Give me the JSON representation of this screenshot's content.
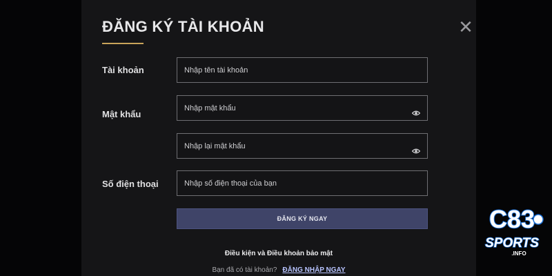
{
  "modal": {
    "title": "ĐĂNG KÝ TÀI KHOẢN",
    "close_glyph": "✕"
  },
  "form": {
    "username": {
      "label": "Tài khoản",
      "placeholder": "Nhập tên tài khoản",
      "value": ""
    },
    "password": {
      "label": "Mật khẩu",
      "placeholder": "Nhập mật khẩu",
      "value": "",
      "icon": "eye-icon"
    },
    "confirm_password": {
      "placeholder": "Nhập lại mật khẩu",
      "value": "",
      "icon": "eye-icon"
    },
    "phone": {
      "label": "Số điện thoại",
      "placeholder": "Nhập số điện thoại của bạn",
      "value": ""
    },
    "submit_label": "ĐĂNG KÝ NGAY"
  },
  "footer": {
    "terms_label": "Điều kiện và Điều khoản bảo mật",
    "login_prompt": "Bạn đã có tài khoản?",
    "login_link": "ĐĂNG NHẬP NGAY"
  },
  "logo": {
    "brand": "C83",
    "sub": "SPORTS",
    "tld": ".INFO"
  },
  "colors": {
    "accent_underline": "#c9a45a",
    "submit_bg": "#3f4468",
    "login_link": "#b8c4ff",
    "logo_blue": "#1a6fd6"
  }
}
